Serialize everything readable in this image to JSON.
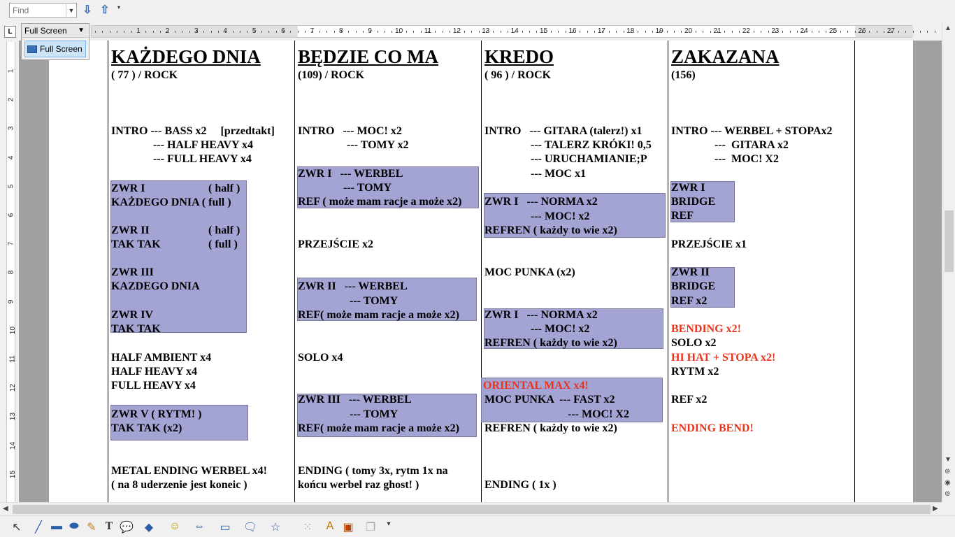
{
  "find": {
    "placeholder": "Find"
  },
  "fullscreen": {
    "title": "Full Screen",
    "button": "Full Screen"
  },
  "ruler": {
    "h": [
      "1",
      "2",
      "3",
      "4",
      "5",
      "6",
      "7",
      "8",
      "9",
      "10",
      "11",
      "12",
      "13",
      "14",
      "15",
      "16",
      "17",
      "18",
      "19",
      "20",
      "21",
      "22",
      "23",
      "24",
      "25",
      "26",
      "27"
    ],
    "v": [
      "1",
      "2",
      "3",
      "4",
      "5",
      "6",
      "7",
      "8",
      "9",
      "10",
      "11",
      "12",
      "13",
      "14",
      "15"
    ]
  },
  "col1": {
    "title": "KAŻDEGO DNIA",
    "tempo": "( 77 ) / ROCK",
    "intro1": "INTRO --- BASS x2     [przedtakt]",
    "intro2": "--- HALF HEAVY x4",
    "intro3": "--- FULL HEAVY x4",
    "z1": "ZWR I",
    "z1r": "( half )",
    "z1b": "KAŻDEGO DNIA ( full )",
    "z2": "ZWR II",
    "z2r": "( half )",
    "z2b": "TAK TAK",
    "z2br": "( full )",
    "z3": "ZWR III",
    "z3b": "KAZDEGO DNIA",
    "z4": "ZWR IV",
    "z4b": "TAK TAK",
    "a1": "HALF AMBIENT x4",
    "a2": "HALF HEAVY x4",
    "a3": "FULL HEAVY x4",
    "z5": "ZWR V ( RYTM! )",
    "z5b": "TAK TAK (x2)",
    "e1": "METAL ENDING WERBEL x4!",
    "e2": "( na 8 uderzenie jest koneic )"
  },
  "col2": {
    "title": "BĘDZIE CO MA",
    "tempo": "(109) / ROCK",
    "i1": "INTRO   --- MOC! x2",
    "i2": "--- TOMY x2",
    "b1a": "ZWR I   --- WERBEL",
    "b1b": "--- TOMY",
    "b1c": "REF ( może mam racje a może x2)",
    "p": "PRZEJŚCIE x2",
    "b2a": "ZWR II   --- WERBEL",
    "b2b": "--- TOMY",
    "b2c": "REF( może mam racje a może x2)",
    "solo": "SOLO x4",
    "b3a": "ZWR III   --- WERBEL",
    "b3b": "--- TOMY",
    "b3c": "REF( może mam racje a może x2)",
    "e1": "ENDING ( tomy 3x, rytm 1x na",
    "e2": "końcu werbel raz ghost! )"
  },
  "col3": {
    "title": "KREDO",
    "tempo": "( 96 ) / ROCK",
    "i1": "INTRO   --- GITARA (talerz!) x1",
    "i2": "--- TALERZ KRÓKI! 0,5",
    "i3": "--- URUCHAMIANIE;P",
    "i4": "--- MOC x1",
    "b1a": "ZWR I   --- NORMA x2",
    "b1b": "--- MOC! x2",
    "b1c": "REFREN ( każdy to wie x2)",
    "m": "MOC PUNKA (x2)",
    "b2a": "ZWR I   --- NORMA x2",
    "b2b": "--- MOC! x2",
    "b2c": "REFREN ( każdy to wie x2)",
    "or": "ORIENTAL MAX x4!",
    "b3b": "MOC PUNKA  --- FAST x2",
    "b3c": "--- MOC! X2",
    "r": "REFREN ( każdy to wie x2)",
    "e": "ENDING ( 1x )"
  },
  "col4": {
    "title": "ZAKAZANA",
    "tempo": "(156)",
    "i1": "INTRO --- WERBEL + STOPAx2",
    "i2": "---  GITARA x2",
    "i3": "---  MOC! X2",
    "b1a": "ZWR I",
    "b1b": "BRIDGE",
    "b1c": "REF",
    "p": "PRZEJŚCIE x1",
    "b2a": "ZWR II",
    "b2b": "BRIDGE",
    "b2c": "REF x2",
    "bend": "BENDING x2!",
    "solo": "SOLO x2",
    "hh": "HI HAT + STOPA x2!",
    "rytm": "RYTM x2",
    "ref": "REF x2",
    "eb": "ENDING BEND!"
  },
  "colors": {
    "highlight": "#a4a4d4",
    "red": "#e8341c"
  }
}
